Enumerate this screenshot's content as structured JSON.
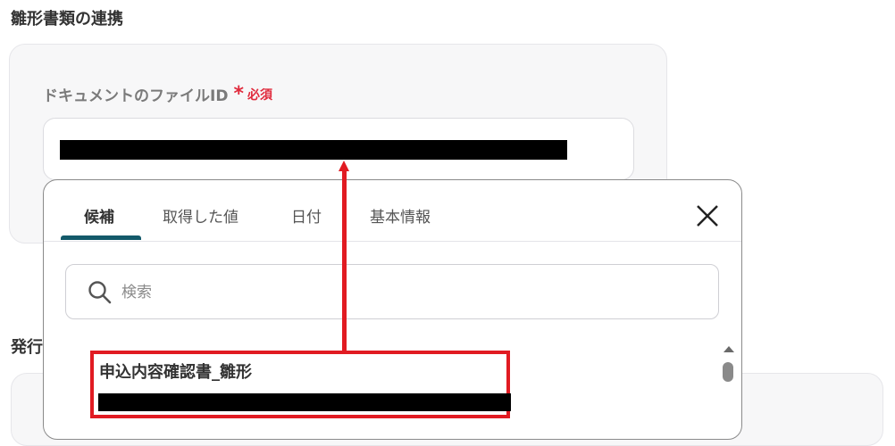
{
  "section": {
    "title": "雛形書類の連携"
  },
  "field": {
    "label": "ドキュメントのファイルID",
    "asterisk": "*",
    "required": "必須"
  },
  "second_section": {
    "title": "発行"
  },
  "popup": {
    "tabs": [
      {
        "label": "候補",
        "active": true
      },
      {
        "label": "取得した値",
        "active": false
      },
      {
        "label": "日付",
        "active": false
      },
      {
        "label": "基本情報",
        "active": false
      }
    ],
    "search": {
      "placeholder": "検索",
      "value": ""
    },
    "items": [
      {
        "title": "申込内容確認書_雛形"
      }
    ]
  },
  "colors": {
    "accent": "#135a6a",
    "required": "#e02a3c",
    "highlight": "#e11b22"
  }
}
